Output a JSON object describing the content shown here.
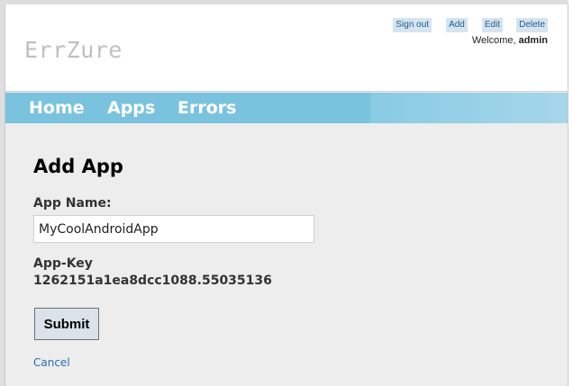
{
  "header": {
    "logo": "ErrZure",
    "actions": {
      "sign_out": "Sign out",
      "add": "Add",
      "edit": "Edit",
      "delete": "Delete"
    },
    "welcome_prefix": "Welcome, ",
    "username": "admin"
  },
  "nav": {
    "items": [
      "Home",
      "Apps",
      "Errors"
    ]
  },
  "form": {
    "title": "Add App",
    "app_name_label": "App Name:",
    "app_name_value": "MyCoolAndroidApp",
    "app_key_label": "App-Key",
    "app_key_value": "1262151a1ea8dcc1088.55035136",
    "submit_label": "Submit",
    "cancel_label": "Cancel"
  },
  "colors": {
    "nav_bar": "#7ac3de",
    "link": "#2a6cb3",
    "top_button_bg": "#d5e4f0"
  }
}
